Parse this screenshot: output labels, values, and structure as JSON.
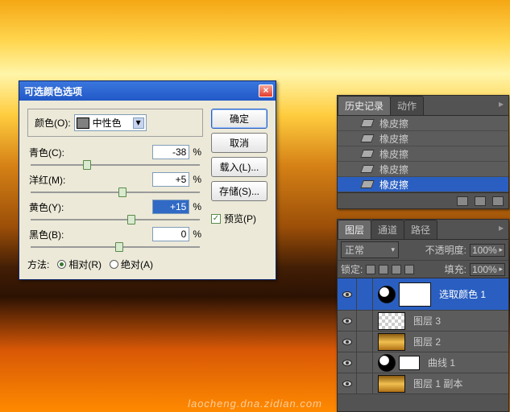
{
  "dialog": {
    "title": "可选颜色选项",
    "color_label": "颜色(O):",
    "color_value": "中性色",
    "sliders": {
      "cyan": {
        "label": "青色(C):",
        "value": "-38",
        "unit": "%",
        "pos": 31
      },
      "magenta": {
        "label": "洋红(M):",
        "value": "+5",
        "unit": "%",
        "pos": 52
      },
      "yellow": {
        "label": "黄色(Y):",
        "value": "+15",
        "unit": "%",
        "pos": 57
      },
      "black": {
        "label": "黑色(B):",
        "value": "0",
        "unit": "%",
        "pos": 50
      }
    },
    "method_label": "方法:",
    "method_rel": "相对(R)",
    "method_abs": "绝对(A)",
    "buttons": {
      "ok": "确定",
      "cancel": "取消",
      "load": "载入(L)...",
      "save": "存储(S)..."
    },
    "preview": "预览(P)"
  },
  "history": {
    "tabs": {
      "history": "历史记录",
      "actions": "动作"
    },
    "items": [
      "橡皮擦",
      "橡皮擦",
      "橡皮擦",
      "橡皮擦",
      "橡皮擦"
    ]
  },
  "layers_panel": {
    "tabs": {
      "layers": "图层",
      "channels": "通道",
      "paths": "路径"
    },
    "blend_label": "正常",
    "opacity_label": "不透明度:",
    "opacity_value": "100%",
    "lock_label": "锁定:",
    "fill_label": "填充:",
    "fill_value": "100%",
    "layers": [
      {
        "name": "选取颜色 1",
        "selected": true,
        "type": "adj"
      },
      {
        "name": "图层 3",
        "type": "checker"
      },
      {
        "name": "图层 2",
        "type": "sky"
      },
      {
        "name": "图层 1 副本",
        "type": "sky"
      }
    ],
    "curves_name": "曲线 1"
  },
  "watermark": "laocheng.dna.zidian.com"
}
